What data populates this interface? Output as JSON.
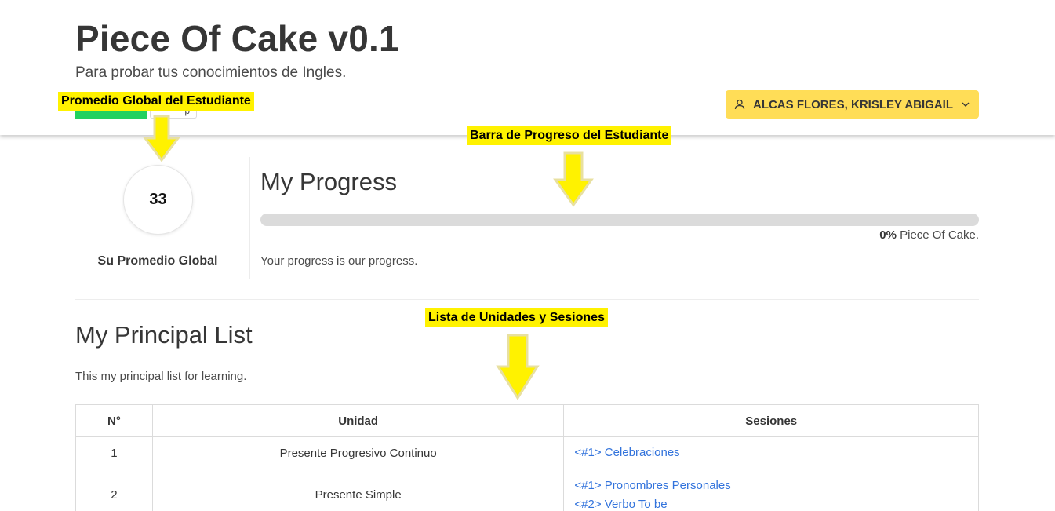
{
  "header": {
    "title": "Piece Of Cake v0.1",
    "subtitle": "Para probar tus conocimientos de Ingles.",
    "user_name": "ALCAS FLORES, KRISLEY ABIGAIL",
    "user_icon": "user-icon",
    "chevron_icon": "chevron-down-icon",
    "partial_button_label": "p"
  },
  "annotations": {
    "global_average": "Promedio Global del Estudiante",
    "progress_bar": "Barra de Progreso del Estudiante",
    "unit_list": "Lista de Unidades y Sesiones"
  },
  "average": {
    "value": "33",
    "label": "Su Promedio Global"
  },
  "progress": {
    "title": "My Progress",
    "percent": 0,
    "percent_label": "0%",
    "caption_suffix": " Piece Of Cake.",
    "note": "Your progress is our progress."
  },
  "list": {
    "title": "My Principal List",
    "description": "This my principal list for learning.",
    "columns": [
      "N°",
      "Unidad",
      "Sesiones"
    ],
    "rows": [
      {
        "n": "1",
        "unit": "Presente Progresivo Continuo",
        "sessions": [
          "<#1> Celebraciones"
        ]
      },
      {
        "n": "2",
        "unit": "Presente Simple",
        "sessions": [
          "<#1> Pronombres Personales",
          "<#2> Verbo To be"
        ]
      }
    ]
  },
  "colors": {
    "accent_yellow": "#ffdd57",
    "success_green": "#23d160",
    "link_blue": "#3273dc",
    "annotation_yellow": "#fff200"
  }
}
